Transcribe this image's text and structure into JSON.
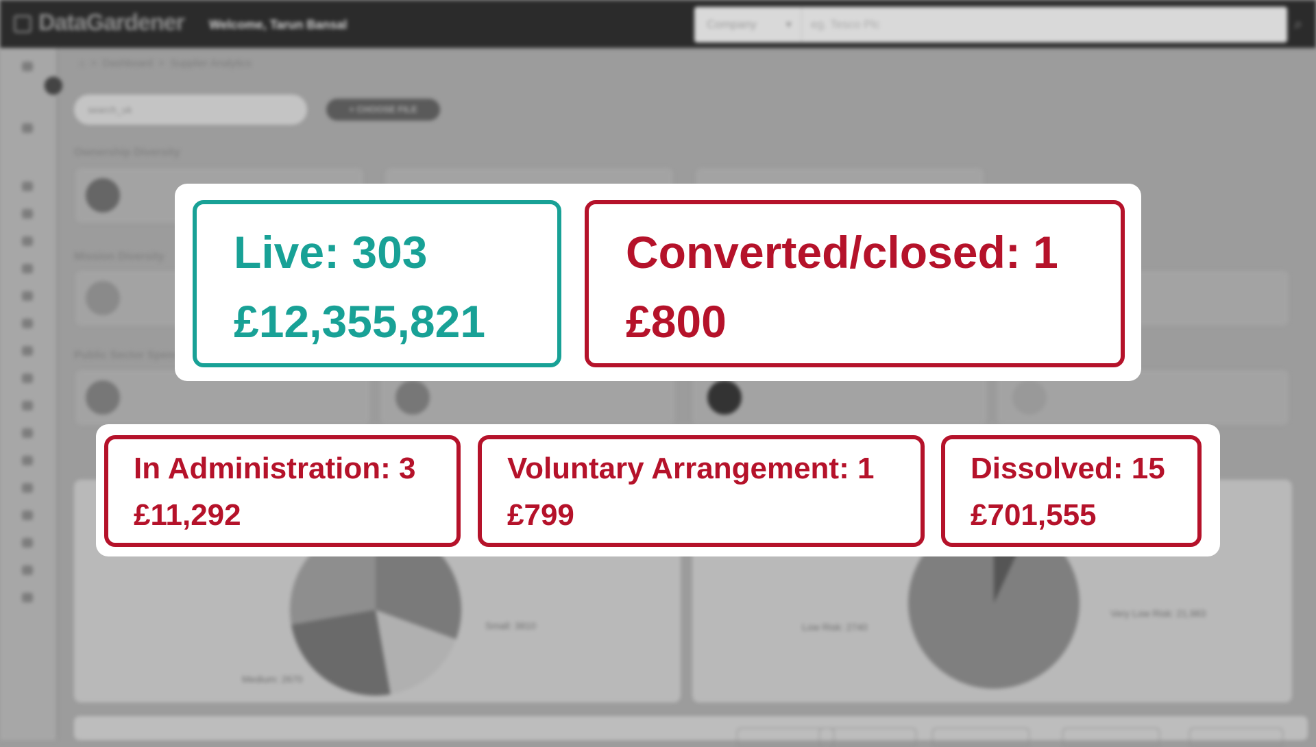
{
  "app": {
    "logo": "DataGardener",
    "welcome": "Welcome, Tarun Bansal"
  },
  "search": {
    "type_value": "Company",
    "placeholder": "eg. Tesco Plc"
  },
  "breadcrumb": {
    "home": "⌂",
    "items": [
      "Dashboard",
      "Supplier Analytics"
    ],
    "separator": ">"
  },
  "filter": {
    "selected": "search_uk",
    "choose_file_label": "+ CHOOSE FILE"
  },
  "sections": {
    "ownership": "Ownership Diversity",
    "mission": "Mission Diversity",
    "public_sector": "Public Sector Spend"
  },
  "pie_labels": {
    "small": "Small: 3810",
    "medium": "Medium: 2670",
    "low_risk": "Low Risk: 2740",
    "very_low_risk": "Very Low Risk: 21,983"
  },
  "stats": {
    "live": {
      "line1": "Live: 303",
      "line2": "£12,355,821",
      "color": "#18a196"
    },
    "converted": {
      "line1": "Converted/closed: 1",
      "line2": "£800",
      "color": "#b5122a"
    },
    "admin": {
      "line1": "In Administration: 3",
      "line2": "£11,292",
      "color": "#b5122a"
    },
    "voluntary": {
      "line1": "Voluntary Arrangement: 1",
      "line2": "£799",
      "color": "#b5122a"
    },
    "dissolved": {
      "line1": "Dissolved: 15",
      "line2": "£701,555",
      "color": "#b5122a"
    }
  },
  "colors": {
    "teal": "#18a196",
    "red": "#b5122a",
    "topbar": "#2b2b2b"
  }
}
